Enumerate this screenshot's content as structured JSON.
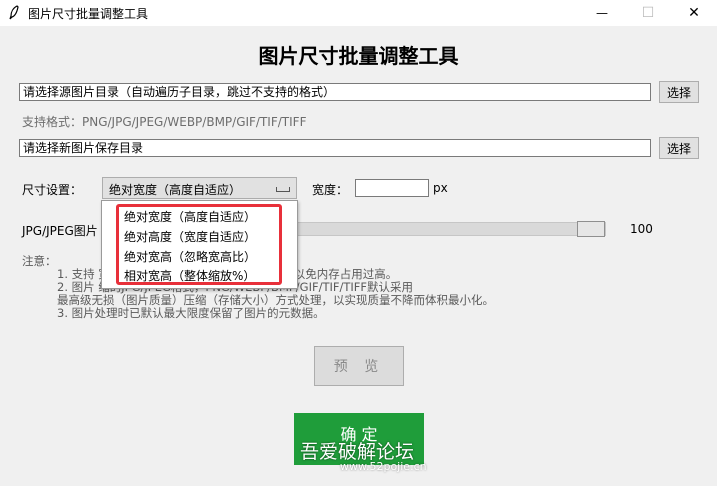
{
  "window": {
    "title": "图片尺寸批量调整工具",
    "minimize_glyph": "—",
    "maximize_glyph": "☐",
    "close_glyph": "✕"
  },
  "heading": "图片尺寸批量调整工具",
  "source_dir": {
    "value": "请选择源图片目录（自动遍历子目录，跳过不支持的格式）",
    "button": "选择"
  },
  "supported_formats": "支持格式：PNG/JPG/JPEG/WEBP/BMP/GIF/TIF/TIFF",
  "save_dir": {
    "value": "请选择新图片保存目录",
    "button": "选择"
  },
  "size": {
    "label": "尺寸设置：",
    "selected": "绝对宽度（高度自适应）",
    "width_label": "宽度：",
    "width_value": "",
    "unit": "px",
    "options": [
      "绝对宽度（高度自适应）",
      "绝对高度（宽度自适应）",
      "绝对宽高（忽略宽高比）",
      "相对宽高（整体缩放%）"
    ]
  },
  "quality": {
    "label": "JPG/JPEG图片",
    "value": "100"
  },
  "notes": {
    "title": "注意：",
    "lines": [
      "1. 支持                              宽*4）*（高*4）px。请勿过度放大，以免内存占用过高。",
      "2. 图片                                   缩的JPG/JPEG格式，PNG/WEBP/BMP/GIF/TIF/TIFF默认采用",
      "   最高级无损（图片质量）压缩（存储大小）方式处理，以实现质量不降而体积最小化。",
      "3. 图片处理时已默认最大限度保留了图片的元数据。"
    ]
  },
  "preview_button": "预 览",
  "confirm_button": "确  定",
  "watermark": {
    "text": "吾爱破解论坛",
    "url": "www.52pojie.cn"
  },
  "colors": {
    "confirm_green": "#1f9d3a",
    "highlight_red": "#e8303a"
  }
}
